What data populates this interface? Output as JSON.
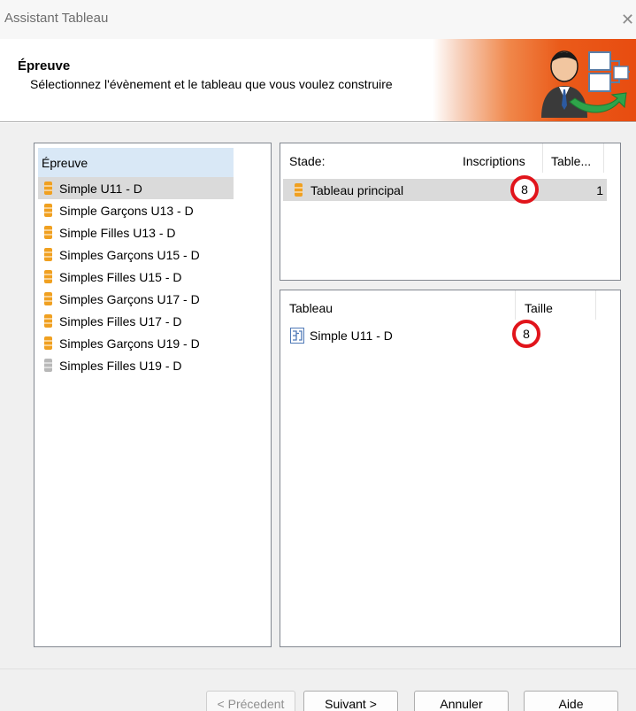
{
  "window": {
    "title": "Assistant Tableau",
    "close_glyph": "✕"
  },
  "banner": {
    "title": "Épreuve",
    "description": "Sélectionnez l'évènement et le tableau que vous voulez construire",
    "icon": "wizard-person-icon"
  },
  "events": {
    "header": "Épreuve",
    "items": [
      {
        "label": "Simple U11 - D",
        "icon": "database-icon",
        "color": "#f0a020"
      },
      {
        "label": "Simple Garçons U13 - D",
        "icon": "database-icon",
        "color": "#f0a020"
      },
      {
        "label": "Simple Filles U13 - D",
        "icon": "database-icon",
        "color": "#f0a020"
      },
      {
        "label": "Simples Garçons U15 - D",
        "icon": "database-icon",
        "color": "#f0a020"
      },
      {
        "label": "Simples Filles U15 - D",
        "icon": "database-icon",
        "color": "#f0a020"
      },
      {
        "label": "Simples Garçons U17 - D",
        "icon": "database-icon",
        "color": "#f0a020"
      },
      {
        "label": "Simples Filles U17 - D",
        "icon": "database-icon",
        "color": "#f0a020"
      },
      {
        "label": "Simples Garçons U19 - D",
        "icon": "database-icon",
        "color": "#f0a020"
      },
      {
        "label": "Simples Filles U19 - D",
        "icon": "database-icon",
        "color": "#b8b8b8"
      }
    ]
  },
  "stage": {
    "columns": {
      "stage": "Stade:",
      "inscriptions": "Inscriptions",
      "tableaux": "Table..."
    },
    "rows": [
      {
        "label": "Tableau principal",
        "inscriptions": "8",
        "tableaux": "1",
        "icon": "database-icon"
      }
    ]
  },
  "draws": {
    "columns": {
      "tableau": "Tableau",
      "taille": "Taille"
    },
    "rows": [
      {
        "label": "Simple U11 - D",
        "taille": "8",
        "icon": "bracket-icon"
      }
    ]
  },
  "buttons": {
    "previous": "< Précedent",
    "next": "Suivant >",
    "cancel": "Annuler",
    "help": "Aide"
  },
  "colors": {
    "accent_orange": "#e84c10",
    "highlight_red": "#e1141b",
    "selection": "#dadada",
    "header_blue": "#d9e8f6"
  }
}
